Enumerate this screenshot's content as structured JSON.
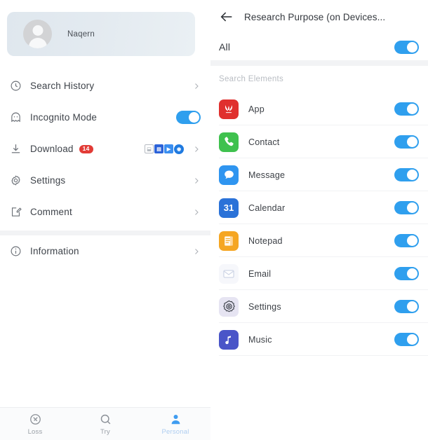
{
  "left": {
    "profile": {
      "name": "Naqern",
      "avatar_icon": "user-avatar-icon"
    },
    "menu_items": [
      {
        "label": "Search History",
        "icon": "clock-icon",
        "control": "chevron",
        "badge": null
      },
      {
        "label": "Incognito Mode",
        "icon": "ghost-icon",
        "control": "toggle",
        "toggle_on": true,
        "badge": null
      },
      {
        "label": "Download",
        "icon": "download-icon",
        "control": "chevron",
        "badge": "14"
      },
      {
        "label": "Settings",
        "icon": "gear-icon",
        "control": "chevron",
        "badge": null
      },
      {
        "label": "Comment",
        "icon": "comment-edit-icon",
        "control": "chevron",
        "badge": null
      },
      {
        "label": "Information",
        "icon": "info-icon",
        "control": "chevron",
        "badge": null
      }
    ],
    "bottom_nav": [
      {
        "label": "Loss",
        "icon": "compass-icon",
        "active": false
      },
      {
        "label": "Try",
        "icon": "search-icon",
        "active": false
      },
      {
        "label": "Personal",
        "icon": "person-icon",
        "active": true
      }
    ]
  },
  "right": {
    "header": {
      "title": "Research Purpose (on Devices...",
      "back_icon": "back-arrow-icon"
    },
    "all_row": {
      "label": "All",
      "toggle_on": true
    },
    "section_title": "Search Elements",
    "apps": [
      {
        "label": "App",
        "icon": "huawei-app-icon",
        "toggle_on": true
      },
      {
        "label": "Contact",
        "icon": "phone-contact-icon",
        "toggle_on": true
      },
      {
        "label": "Message",
        "icon": "message-bubble-icon",
        "toggle_on": true
      },
      {
        "label": "Calendar",
        "icon": "calendar-icon",
        "icon_text": "31",
        "toggle_on": true
      },
      {
        "label": "Notepad",
        "icon": "notepad-icon",
        "toggle_on": true
      },
      {
        "label": "Email",
        "icon": "email-envelope-icon",
        "toggle_on": true
      },
      {
        "label": "Settings",
        "icon": "settings-gear-icon",
        "toggle_on": true
      },
      {
        "label": "Music",
        "icon": "music-note-icon",
        "toggle_on": true
      }
    ]
  },
  "colors": {
    "toggle_on": "#2f9fee",
    "badge": "#e23b36",
    "accent": "#3f9cf0"
  }
}
